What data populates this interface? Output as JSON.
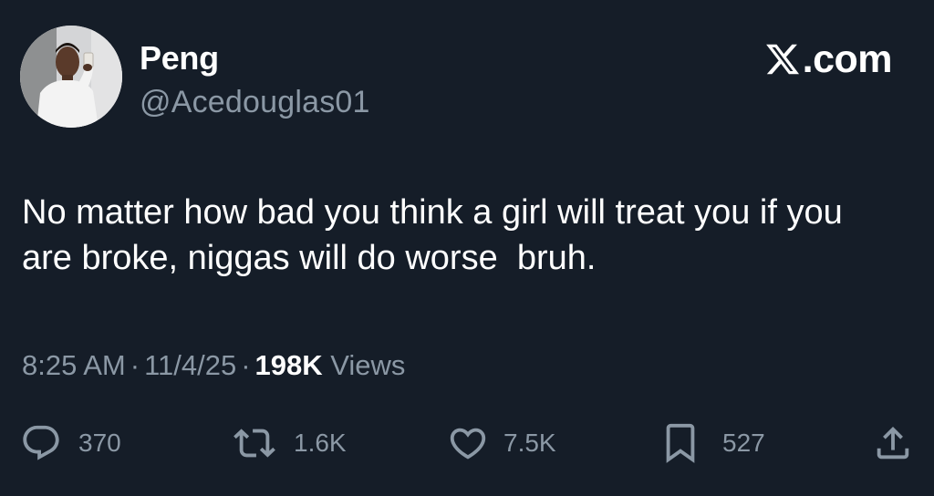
{
  "author": {
    "display_name": "Peng",
    "handle": "@Acedouglas01"
  },
  "brand": {
    "label": ".com",
    "logo_icon": "x-logo-icon"
  },
  "tweet": {
    "text": "No matter how bad you think a girl will treat you if you are broke, niggas will do worse  bruh."
  },
  "meta": {
    "time": "8:25 AM",
    "separator": "·",
    "date": "11/4/25",
    "views_count": "198K",
    "views_label": "Views"
  },
  "actions": {
    "replies": "370",
    "reposts": "1.6K",
    "likes": "7.5K",
    "bookmarks": "527"
  },
  "colors": {
    "background": "#151d28",
    "text_primary": "#ffffff",
    "text_secondary": "#8b98a5"
  }
}
